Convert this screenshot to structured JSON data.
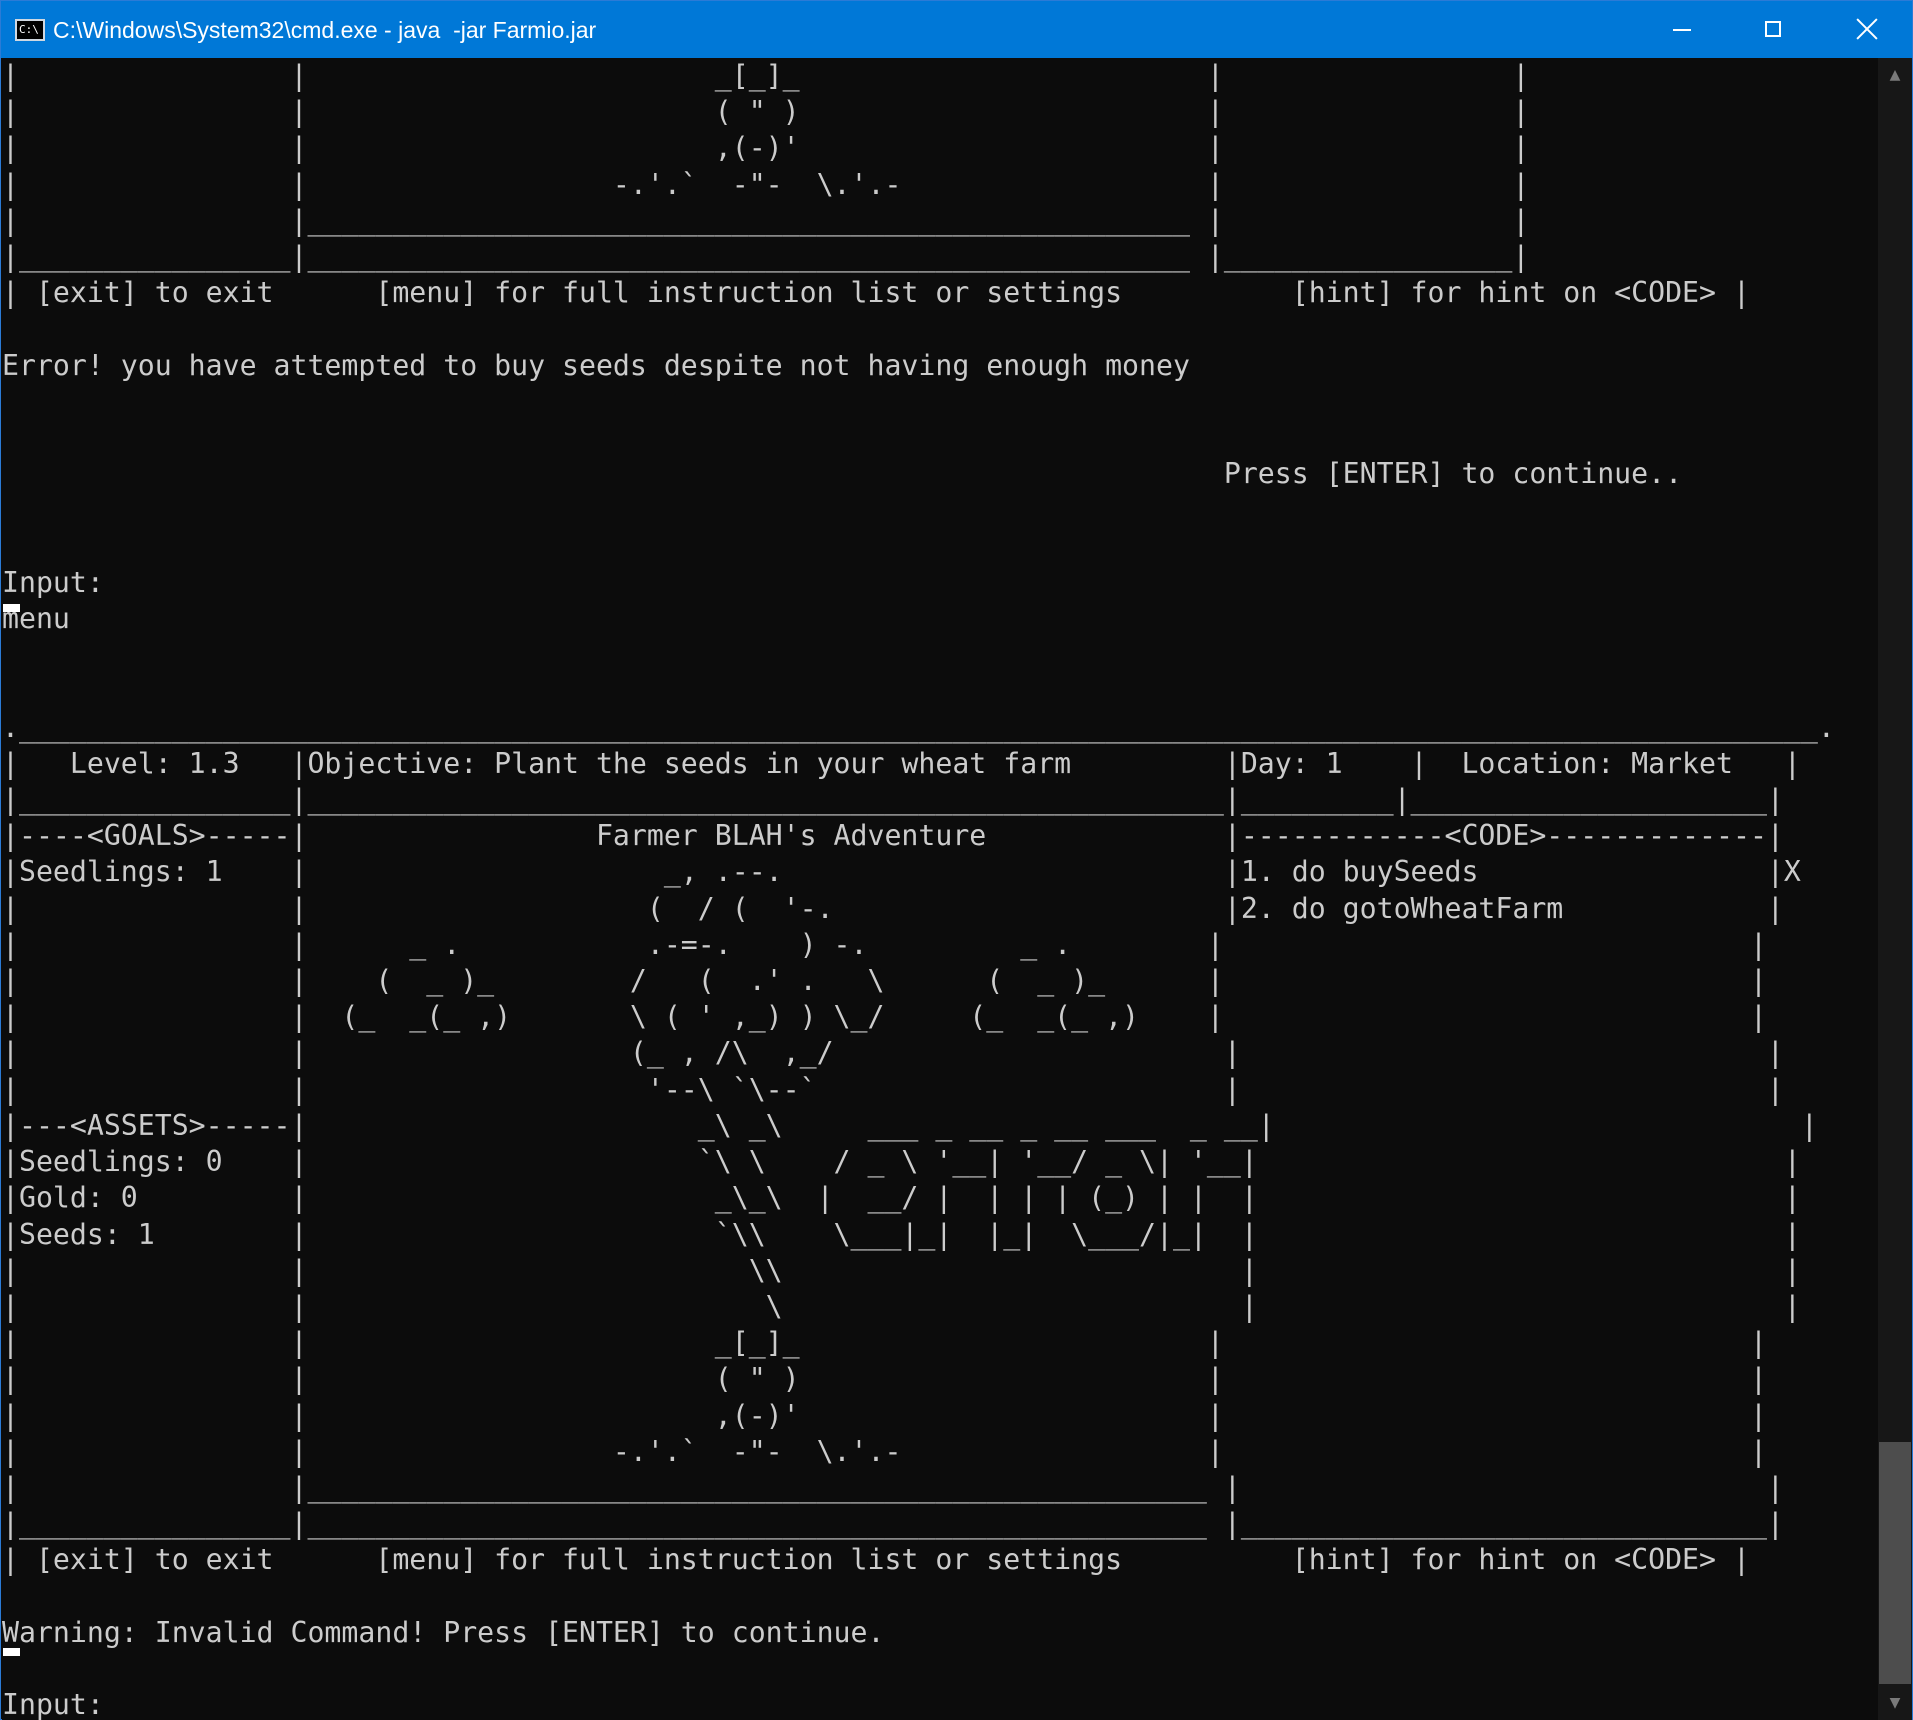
{
  "window": {
    "title": "C:\\Windows\\System32\\cmd.exe - java  -jar Farmio.jar",
    "icon_label": "C:\\",
    "minimize_glyph": "minimize-icon",
    "maximize_glyph": "maximize-icon",
    "close_glyph": "close-icon"
  },
  "console": {
    "lines": [
      "|                |                        _[_]_                        |                 |",
      "|                |                        ( \" )                        |                 |",
      "|                |                        ,(-)'                        |                 |",
      "|                |                  -.'.`  -\"-  \\.'.-                  |                 |",
      "|                |____________________________________________________ |                 |",
      "|________________|____________________________________________________ |_________________|",
      "| [exit] to exit      [menu] for full instruction list or settings          [hint] for hint on <CODE> |",
      "",
      "Error! you have attempted to buy seeds despite not having enough money",
      "",
      "",
      "                                                                        Press [ENTER] to continue..",
      "",
      "",
      "Input:",
      "menu",
      "",
      "",
      ".__________________________________________________________________________________________________________.",
      "|   Level: 1.3   |Objective: Plant the seeds in your wheat farm         |Day: 1    |  Location: Market   |",
      "|________________|______________________________________________________|_________|_____________________|",
      "|----<GOALS>-----|                 Farmer BLAH's Adventure              |------------<CODE>-------------|",
      "|Seedlings: 1    |                     _, .--.                          |1. do buySeeds                 |X",
      "|                |                    (  / (  '-.                       |2. do gotoWheatFarm            |",
      "|                |      _ .           .-=-.    ) -.         _ .        |                               |",
      "|                |    (  _ )_        /   (  .' .   \\      (  _ )_      |                               |",
      "|                |  (_  _(_ ,)       \\ ( ' ,_) ) \\_/     (_  _(_ ,)    |                               |",
      "|                |                   (_ , /\\  ,_/                       |                               |",
      "|                |                    '--\\ `\\--`                        |                               |",
      "|---<ASSETS>-----|                       _\\ _\\     ___ _ __ _ __ ___  _ __|                               |",
      "|Seedlings: 0    |                       `\\ \\    / _ \\ '__| '__/ _ \\| '__|                               |",
      "|Gold: 0         |                        _\\_\\  |  __/ |  | | | (_) | |  |                               |",
      "|Seeds: 1        |                        `\\\\    \\___|_|  |_|  \\___/|_|  |                               |",
      "|                |                          \\\\                           |                               |",
      "|                |                           \\                           |                               |",
      "|                |                        _[_]_                        |                               |",
      "|                |                        ( \" )                        |                               |",
      "|                |                        ,(-)'                        |                               |",
      "|                |                  -.'.`  -\"-  \\.'.-                  |                               |",
      "|                |_____________________________________________________ |                               |",
      "|________________|_____________________________________________________ |_______________________________|",
      "| [exit] to exit      [menu] for full instruction list or settings          [hint] for hint on <CODE> |",
      "",
      "Warning: Invalid Command! Press [ENTER] to continue.",
      "",
      "Input:"
    ]
  },
  "scrollbar": {
    "up_arrow": "▲",
    "down_arrow": "▼"
  }
}
